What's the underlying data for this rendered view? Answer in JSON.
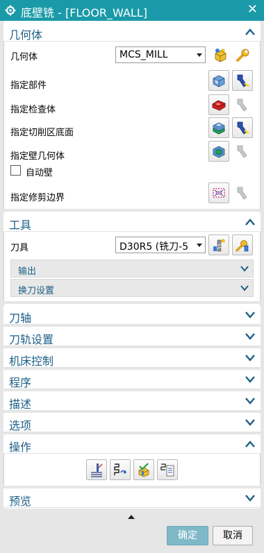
{
  "window": {
    "title": "底壁铣 - [FLOOR_WALL]",
    "close_glyph": "✕"
  },
  "sections": {
    "geometry": {
      "label": "几何体",
      "expanded": true,
      "geometry_label": "几何体",
      "geometry_value": "MCS_MILL",
      "specify_part": "指定部件",
      "specify_check": "指定检查体",
      "specify_cut_floor": "指定切削区底面",
      "specify_wall": "指定壁几何体",
      "auto_wall_label": "自动壁",
      "auto_wall_checked": false,
      "specify_trim": "指定修剪边界"
    },
    "tool": {
      "label": "工具",
      "expanded": true,
      "tool_label": "刀具",
      "tool_value": "D30R5 (铣刀-5",
      "output_label": "输出",
      "tool_change_label": "换刀设置"
    },
    "tool_axis": {
      "label": "刀轴"
    },
    "path_settings": {
      "label": "刀轨设置"
    },
    "machine_control": {
      "label": "机床控制"
    },
    "program": {
      "label": "程序"
    },
    "description": {
      "label": "描述"
    },
    "options": {
      "label": "选项"
    },
    "actions": {
      "label": "操作",
      "expanded": true
    },
    "preview": {
      "label": "预览"
    }
  },
  "footer": {
    "ok_label": "确定",
    "cancel_label": "取消"
  },
  "colors": {
    "title_bar": "#1a9aa8",
    "section_text": "#1c5f86",
    "ok_button": "#7fb8c8"
  }
}
